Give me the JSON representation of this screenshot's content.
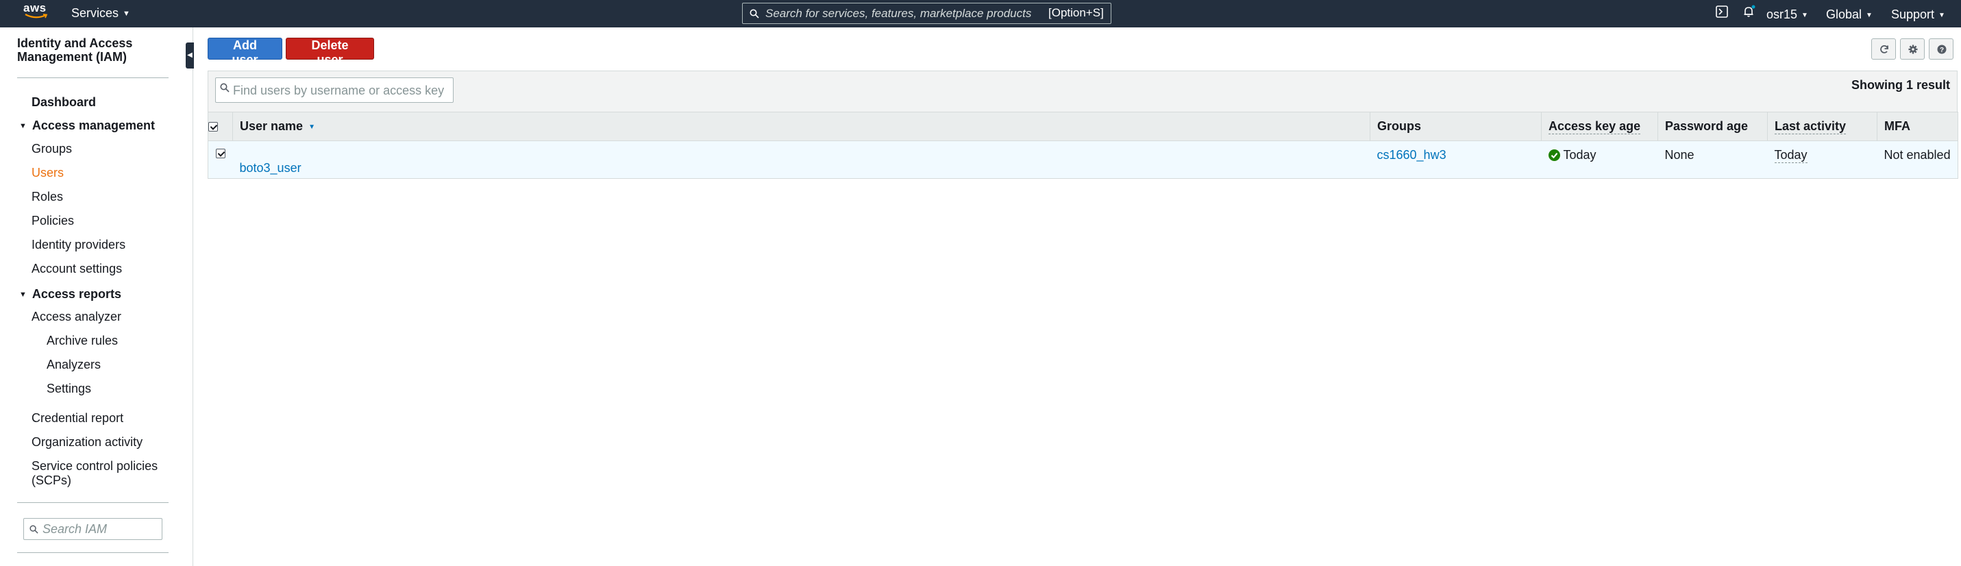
{
  "topnav": {
    "logo_text": "aws",
    "services_label": "Services",
    "search_placeholder": "Search for services, features, marketplace products",
    "search_shortcut": "[Option+S]",
    "user_label": "osr15",
    "region_label": "Global",
    "support_label": "Support",
    "icons": [
      "cloudshell-icon",
      "bell-icon"
    ]
  },
  "sidebar": {
    "title": "Identity and Access Management (IAM)",
    "dashboard": "Dashboard",
    "access_management": {
      "label": "Access management",
      "items": [
        "Groups",
        "Users",
        "Roles",
        "Policies",
        "Identity providers",
        "Account settings"
      ],
      "active": "Users"
    },
    "access_reports": {
      "label": "Access reports",
      "items": [
        "Access analyzer",
        "Archive rules",
        "Analyzers",
        "Settings",
        "Credential report",
        "Organization activity",
        "Service control policies (SCPs)"
      ]
    },
    "search_placeholder": "Search IAM"
  },
  "toolbar": {
    "add_user": "Add user",
    "delete_user": "Delete user",
    "icons": [
      "refresh-icon",
      "gear-icon",
      "help-icon"
    ]
  },
  "filter": {
    "placeholder": "Find users by username or access key",
    "result_count": "Showing 1 result"
  },
  "table": {
    "columns": [
      "User name",
      "Groups",
      "Access key age",
      "Password age",
      "Last activity",
      "MFA"
    ],
    "rows": [
      {
        "checked": true,
        "user_name": "boto3_user",
        "groups": "cs1660_hw3",
        "access_key_age": "Today",
        "password_age": "None",
        "last_activity": "Today",
        "mfa": "Not enabled"
      }
    ]
  },
  "colors": {
    "nav_bg": "#232f3e",
    "active_link": "#ec7211",
    "primary_button": "#3377cc",
    "danger_button": "#c7221c",
    "link": "#0073bb",
    "selected_row": "#f1faff",
    "status_ok": "#1d8102"
  }
}
